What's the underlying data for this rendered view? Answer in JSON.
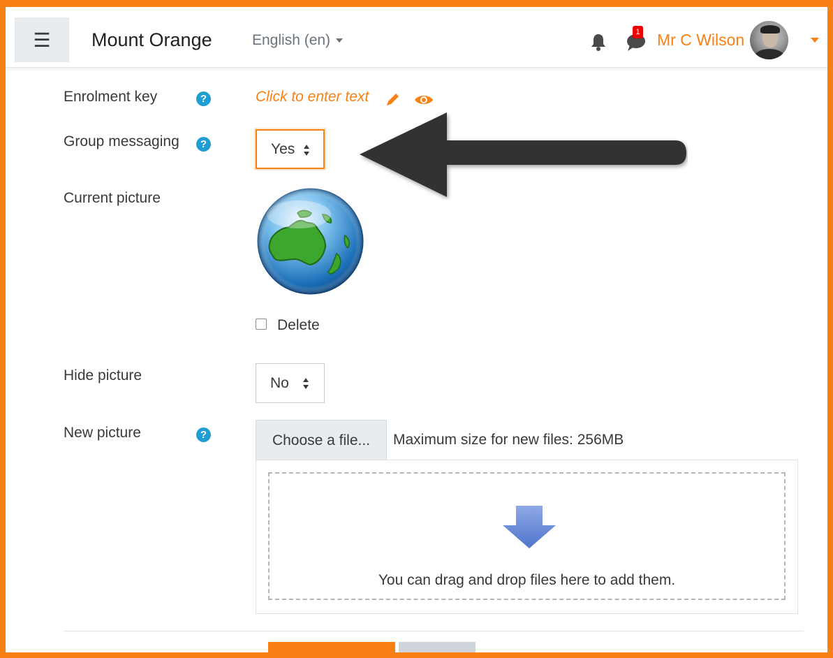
{
  "navbar": {
    "menu_icon": "hamburger-icon",
    "site_name": "Mount Orange",
    "language": "English (en)",
    "notification_icon": "bell-icon",
    "messages_icon": "chat-icon",
    "message_count": "1",
    "user_name": "Mr C Wilson"
  },
  "form": {
    "enrolment_key": {
      "label": "Enrolment key",
      "value_placeholder": "Click to enter text",
      "help_icon": "help-icon",
      "edit_icon": "pencil-icon",
      "reveal_icon": "eye-icon"
    },
    "group_messaging": {
      "label": "Group messaging",
      "selected": "Yes"
    },
    "current_picture": {
      "label": "Current picture",
      "delete_label": "Delete",
      "delete_checked": false
    },
    "hide_picture": {
      "label": "Hide picture",
      "selected": "No"
    },
    "new_picture": {
      "label": "New picture",
      "choose_button": "Choose a file...",
      "max_size": "Maximum size for new files: 256MB",
      "drop_text": "You can drag and drop files here to add them."
    }
  },
  "colors": {
    "brand": "#f98012",
    "help": "#1f9ed4",
    "arrow": "#3a3a3a"
  }
}
